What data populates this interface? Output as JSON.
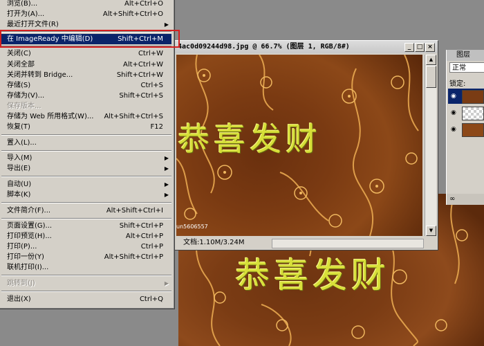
{
  "file_menu": {
    "items": [
      {
        "label": "浏览(B)...",
        "shortcut": "Alt+Ctrl+O"
      },
      {
        "label": "打开为(A)...",
        "shortcut": "Alt+Shift+Ctrl+O"
      },
      {
        "label": "最近打开文件(R)"
      },
      {
        "label": "在 ImageReady 中编辑(D)",
        "shortcut": "Shift+Ctrl+M"
      },
      {
        "label": "关闭(C)",
        "shortcut": "Ctrl+W"
      },
      {
        "label": "关闭全部",
        "shortcut": "Alt+Ctrl+W"
      },
      {
        "label": "关闭并转到 Bridge...",
        "shortcut": "Shift+Ctrl+W"
      },
      {
        "label": "存储(S)",
        "shortcut": "Ctrl+S"
      },
      {
        "label": "存储为(V)...",
        "shortcut": "Shift+Ctrl+S"
      },
      {
        "label": "保存版本..."
      },
      {
        "label": "存储为 Web 所用格式(W)...",
        "shortcut": "Alt+Shift+Ctrl+S"
      },
      {
        "label": "恢复(T)",
        "shortcut": "F12"
      },
      {
        "label": "置入(L)..."
      },
      {
        "label": "导入(M)"
      },
      {
        "label": "导出(E)"
      },
      {
        "label": "自动(U)"
      },
      {
        "label": "脚本(K)"
      },
      {
        "label": "文件简介(F)...",
        "shortcut": "Alt+Shift+Ctrl+I"
      },
      {
        "label": "页面设置(G)...",
        "shortcut": "Shift+Ctrl+P"
      },
      {
        "label": "打印预览(H)...",
        "shortcut": "Alt+Ctrl+P"
      },
      {
        "label": "打印(P)...",
        "shortcut": "Ctrl+P"
      },
      {
        "label": "打印一份(Y)",
        "shortcut": "Alt+Shift+Ctrl+P"
      },
      {
        "label": "联机打印(I)..."
      },
      {
        "label": "跳转到(J)"
      },
      {
        "label": "退出(X)",
        "shortcut": "Ctrl+Q"
      }
    ]
  },
  "document": {
    "title": "4ac0d09244d98.jpg @ 66.7% (图层 1, RGB/8#)",
    "status": "文档:1.10M/3.24M",
    "canvas_text": "恭喜发财",
    "canvas_tag": "un5606557"
  },
  "background_canvas": {
    "text": "恭喜发财"
  },
  "layers_panel": {
    "tab_label": "图层",
    "blend_mode": "正常",
    "lock_label": "锁定:"
  },
  "colors": {
    "menu_highlight": "#0a246a",
    "annotation_box": "#d42020",
    "canvas_text": "#d6de38"
  }
}
